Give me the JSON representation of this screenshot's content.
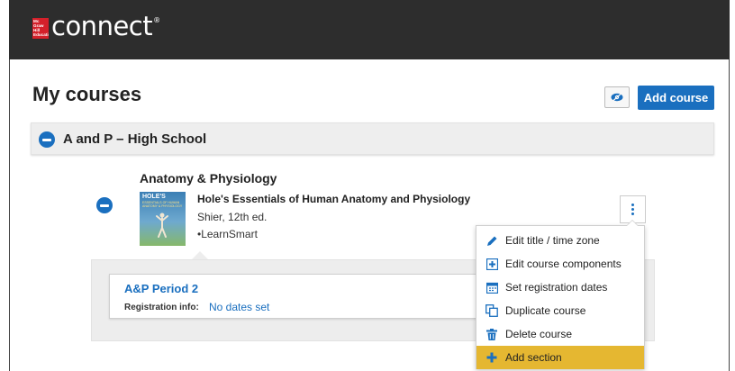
{
  "brand": {
    "logo_lines": [
      "Mc",
      "Graw",
      "Hill",
      "Education"
    ],
    "product_name": "connect",
    "trademark": "®"
  },
  "page": {
    "title": "My courses",
    "add_course_label": "Add course",
    "eye_icon": "eye-icon"
  },
  "group": {
    "title": "A and P – High School"
  },
  "course": {
    "title": "Anatomy & Physiology",
    "book": {
      "cover_brand": "HOLE'S",
      "cover_subtitle": "ESSENTIALS OF HUMAN ANATOMY & PHYSIOLOGY",
      "title": "Hole's Essentials of Human Anatomy and Physiology",
      "author_edition": "Shier, 12th ed.",
      "product": "•LearnSmart"
    }
  },
  "section": {
    "name": "A&P Period 2",
    "registration_label": "Registration info:",
    "registration_value": "No dates set"
  },
  "menu": {
    "items": [
      {
        "label": "Edit title / time zone",
        "icon": "pencil-icon"
      },
      {
        "label": "Edit course components",
        "icon": "plus-square-icon"
      },
      {
        "label": "Set registration dates",
        "icon": "calendar-icon"
      },
      {
        "label": "Duplicate course",
        "icon": "duplicate-icon"
      },
      {
        "label": "Delete course",
        "icon": "trash-icon"
      },
      {
        "label": "Add section",
        "icon": "plus-icon"
      }
    ],
    "highlighted_index": 5
  },
  "colors": {
    "accent": "#1a6fbf",
    "topbar": "#2d2d2d",
    "highlight": "#e5b731",
    "logo_red": "#d4202a"
  }
}
